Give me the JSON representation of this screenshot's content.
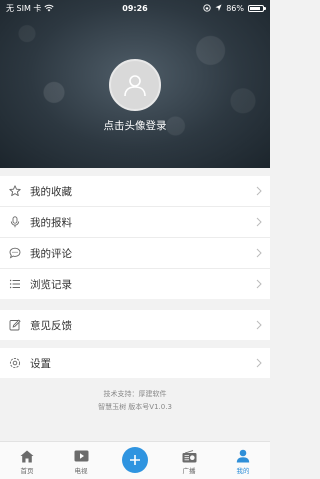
{
  "status_bar": {
    "carrier": "无 SIM 卡",
    "time": "09:26",
    "battery_percent": "86%",
    "battery_level": 0.86
  },
  "profile": {
    "login_prompt": "点击头像登录"
  },
  "menu_group_1": [
    {
      "label": "我的收藏",
      "icon": "star-icon"
    },
    {
      "label": "我的报料",
      "icon": "microphone-icon"
    },
    {
      "label": "我的评论",
      "icon": "comment-icon"
    },
    {
      "label": "浏览记录",
      "icon": "list-icon"
    }
  ],
  "menu_group_2": [
    {
      "label": "意见反馈",
      "icon": "edit-icon"
    }
  ],
  "menu_group_3": [
    {
      "label": "设置",
      "icon": "gear-icon"
    }
  ],
  "footer": {
    "support": "技术支持：厚建软件",
    "version": "智慧玉树  版本号V1.0.3"
  },
  "tabbar": {
    "home": "首页",
    "tv": "电视",
    "radio": "广播",
    "mine": "我的",
    "accent": "#2f94e0"
  }
}
